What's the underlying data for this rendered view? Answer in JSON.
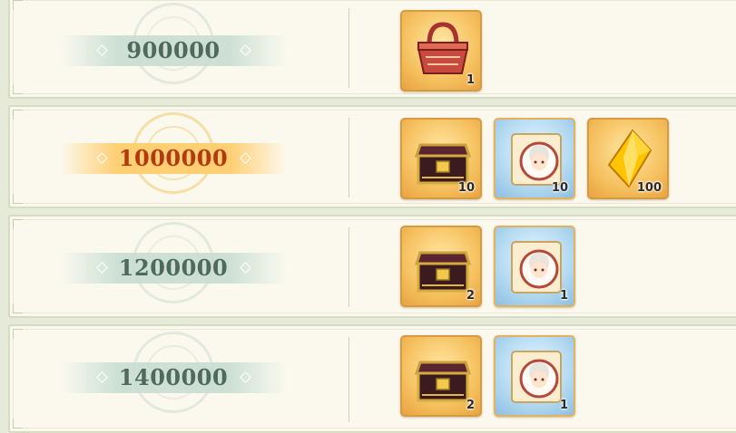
{
  "tiers": [
    {
      "score": "900000",
      "rewards": [
        {
          "icon": "gift-basket-icon",
          "count": "1"
        }
      ]
    },
    {
      "score": "1000000",
      "rewards": [
        {
          "icon": "treasure-chest-icon",
          "count": "10"
        },
        {
          "icon": "character-scroll-icon",
          "count": "10"
        },
        {
          "icon": "gold-crystal-icon",
          "count": "100"
        }
      ]
    },
    {
      "score": "1200000",
      "rewards": [
        {
          "icon": "treasure-chest-icon",
          "count": "2"
        },
        {
          "icon": "character-scroll-icon",
          "count": "1"
        }
      ]
    },
    {
      "score": "1400000",
      "rewards": [
        {
          "icon": "treasure-chest-icon",
          "count": "2"
        },
        {
          "icon": "character-scroll-icon",
          "count": "1"
        }
      ]
    }
  ],
  "colors": {
    "panel": "#fbf9ee",
    "score_normal": "#4e6a5c",
    "score_highlight": "#b23a10",
    "band_normal": "#c6dcd2",
    "band_highlight": "#ffcd6e",
    "reward_gold": "#f6c160",
    "reward_blue": "#b7dcf2"
  }
}
